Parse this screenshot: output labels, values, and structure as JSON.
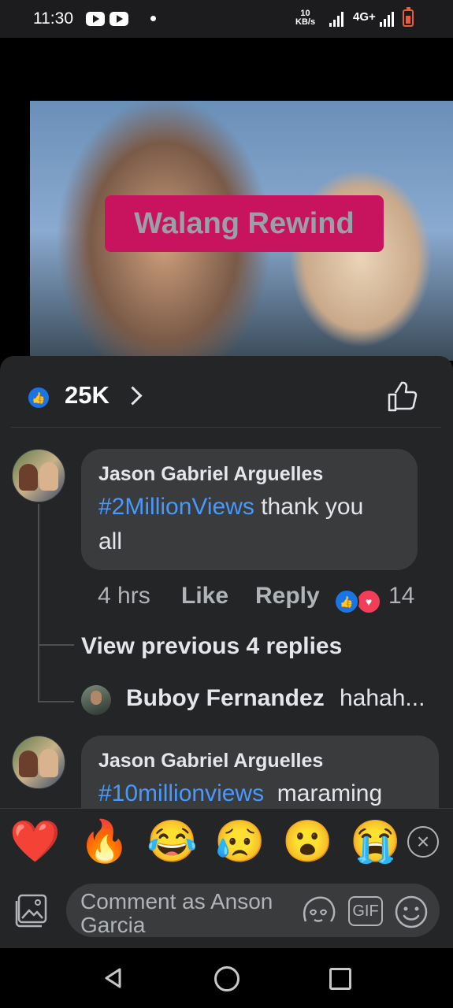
{
  "status_bar": {
    "time": "11:30",
    "net_speed_value": "10",
    "net_speed_unit": "KB/s",
    "network_type": "4G+"
  },
  "video": {
    "caption": "Walang Rewind"
  },
  "reactions_summary": {
    "count": "25K",
    "icon": "like-icon"
  },
  "comments": [
    {
      "author": "Jason Gabriel Arguelles",
      "hashtag": "#2MillionViews",
      "text_line1": " thank you",
      "text_line2": "all",
      "time": "4 hrs",
      "like_label": "Like",
      "reply_label": "Reply",
      "reaction_count": "14"
    },
    {
      "author": "Jason Gabriel Arguelles",
      "hashtag": "#10millionviews",
      "text_line1": "  maraming"
    }
  ],
  "thread": {
    "view_previous": "View previous 4 replies",
    "reply_author": "Buboy Fernandez",
    "reply_text": "hahah..."
  },
  "emoji_bar": {
    "items": [
      "❤️",
      "🔥",
      "😂",
      "😥",
      "😮",
      "😭"
    ]
  },
  "composer": {
    "placeholder_line1": "Comment as Anson",
    "placeholder_line2": "Garcia",
    "gif_label": "GIF"
  }
}
